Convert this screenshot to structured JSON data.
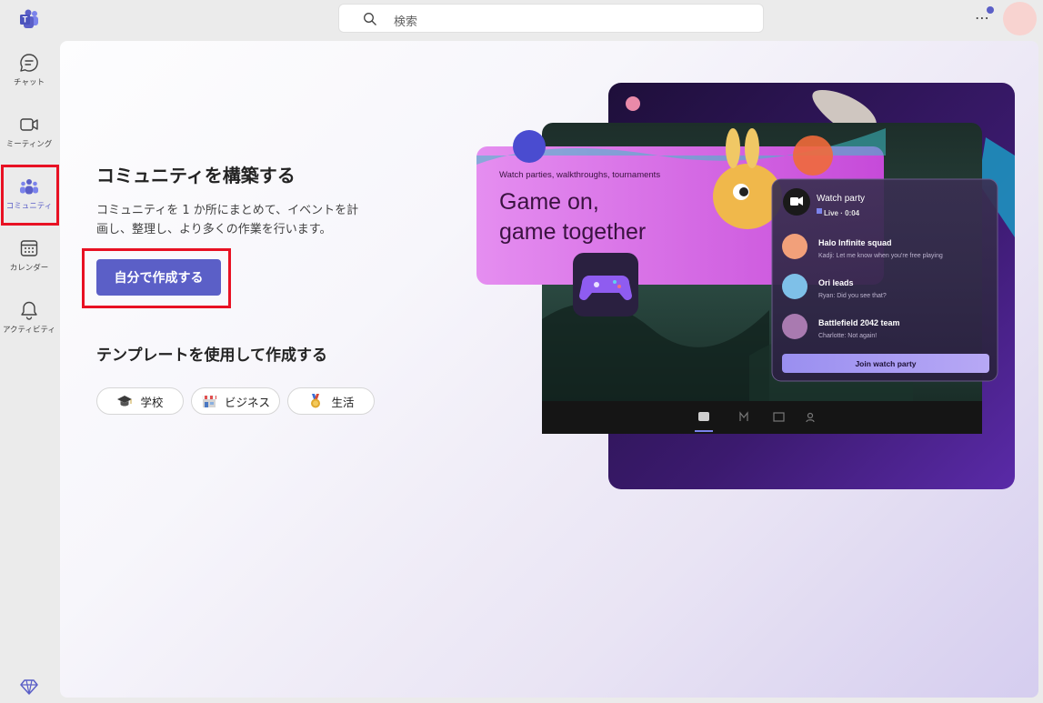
{
  "search": {
    "placeholder": "検索"
  },
  "rail": {
    "items": [
      {
        "label": "チャット"
      },
      {
        "label": "ミーティング"
      },
      {
        "label": "コミュニティ"
      },
      {
        "label": "カレンダー"
      },
      {
        "label": "アクティビティ"
      }
    ]
  },
  "main": {
    "title": "コミュニティを構築する",
    "description": "コミュニティを 1 か所にまとめて、イベントを計画し、整理し、より多くの作業を行います。",
    "create_button": "自分で作成する",
    "templates_title": "テンプレートを使用して作成する",
    "chips": [
      {
        "label": "学校",
        "icon": "graduation-cap-icon"
      },
      {
        "label": "ビジネス",
        "icon": "shop-icon"
      },
      {
        "label": "生活",
        "icon": "medal-icon"
      }
    ]
  },
  "illustration": {
    "tagline": "Watch parties, walkthroughs, tournaments",
    "headline_line1": "Game on,",
    "headline_line2": "game together",
    "card_title": "Watch party",
    "card_status": "Live · 0:04",
    "threads": [
      {
        "name": "Halo Infinite squad",
        "message": "Kadji: Let me know when you're free playing"
      },
      {
        "name": "Ori leads",
        "message": "Ryan: Did you see that?"
      },
      {
        "name": "Battlefield 2042 team",
        "message": "Charlotte: Not again!"
      }
    ],
    "join_button": "Join watch party"
  },
  "colors": {
    "accent": "#5b5fc7",
    "highlight": "#e81123"
  }
}
